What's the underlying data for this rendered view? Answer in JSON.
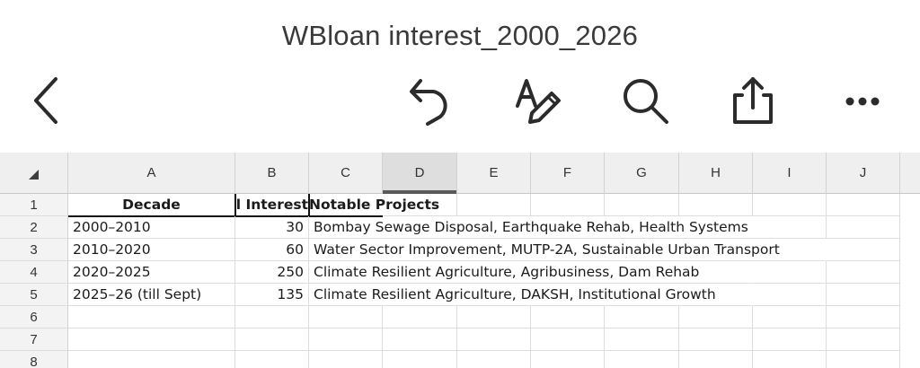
{
  "app": {
    "file_title": "WBloan interest_2000_2026"
  },
  "toolbar": {
    "icons": [
      "back-chevron-icon",
      "undo-icon",
      "text-format-pen-icon",
      "search-icon",
      "share-icon",
      "more-icon"
    ]
  },
  "sheet": {
    "columns": [
      "A",
      "B",
      "C",
      "D",
      "E",
      "F",
      "G",
      "H",
      "I",
      "J"
    ],
    "selected_column": "D",
    "row_numbers": [
      "1",
      "2",
      "3",
      "4",
      "5",
      "6",
      "7",
      "8"
    ],
    "header_row": {
      "decade": "Decade",
      "annual_interest": "Annual Interest",
      "notable_projects": "Notable Projects"
    },
    "rows": [
      {
        "decade": "2000–2010",
        "interest": "30",
        "projects": "Bombay Sewage Disposal, Earthquake Rehab, Health Systems"
      },
      {
        "decade": "2010–2020",
        "interest": "60",
        "projects": "Water Sector Improvement, MUTP-2A, Sustainable Urban Transport"
      },
      {
        "decade": "2020–2025",
        "interest": "250",
        "projects": "Climate Resilient Agriculture, Agribusiness, Dam Rehab"
      },
      {
        "decade": "2025–26 (till Sept)",
        "interest": "135",
        "projects": "Climate Resilient Agriculture, DAKSH, Institutional Growth"
      }
    ]
  }
}
